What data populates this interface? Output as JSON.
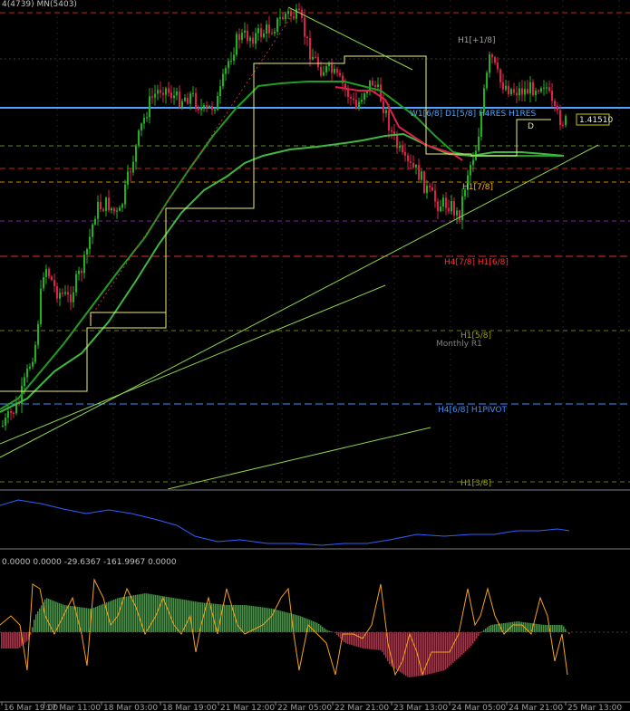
{
  "header": {
    "left_text": "4(4739) MN(5403)"
  },
  "oscillator": {
    "values_text": "0.0000 0.0000 -29.6367 -161.9967 0.0000"
  },
  "colors": {
    "bull": "#1db31d",
    "bear": "#e0204a",
    "ma": "#1f9e1f",
    "trend": "#8fd34a",
    "box": "#ecec7a",
    "blue": "#3060ff",
    "hist_up": "#2fa52f",
    "hist_down": "#d42040",
    "osc_line": "#f5a21d"
  },
  "chart_data": {
    "type": "candlestick",
    "current_price": "1.41510",
    "x_tick_labels": [
      "16 Mar 19:00",
      "17 Mar 11:00",
      "18 Mar 03:00",
      "18 Mar 19:00",
      "21 Mar 12:00",
      "22 Mar 05:00",
      "22 Mar 21:00",
      "23 Mar 13:00",
      "24 Mar 05:00",
      "24 Mar 21:00",
      "25 Mar 13:00"
    ],
    "murrey_levels": [
      {
        "label": "H1[+1/8]",
        "color": "#a0a0a0"
      },
      {
        "label": "W1[6/8] D1[5/8] H4RES H1RES",
        "color": "#4da3ff"
      },
      {
        "label": "D",
        "color": "#e8e860"
      },
      {
        "label": "H1[7/8]",
        "color": "#ffb400"
      },
      {
        "label": "H4[7/8] H1[6/8]",
        "color": "#ff3030"
      },
      {
        "label": "H1[5/8]",
        "color": "#a0a000"
      },
      {
        "label": "Monthly R1",
        "color": "#808080"
      },
      {
        "label": "H4[6/8] H1PIVOT",
        "color": "#3f8fff"
      },
      {
        "label": "H1[3/8]",
        "color": "#a0a000"
      }
    ]
  }
}
